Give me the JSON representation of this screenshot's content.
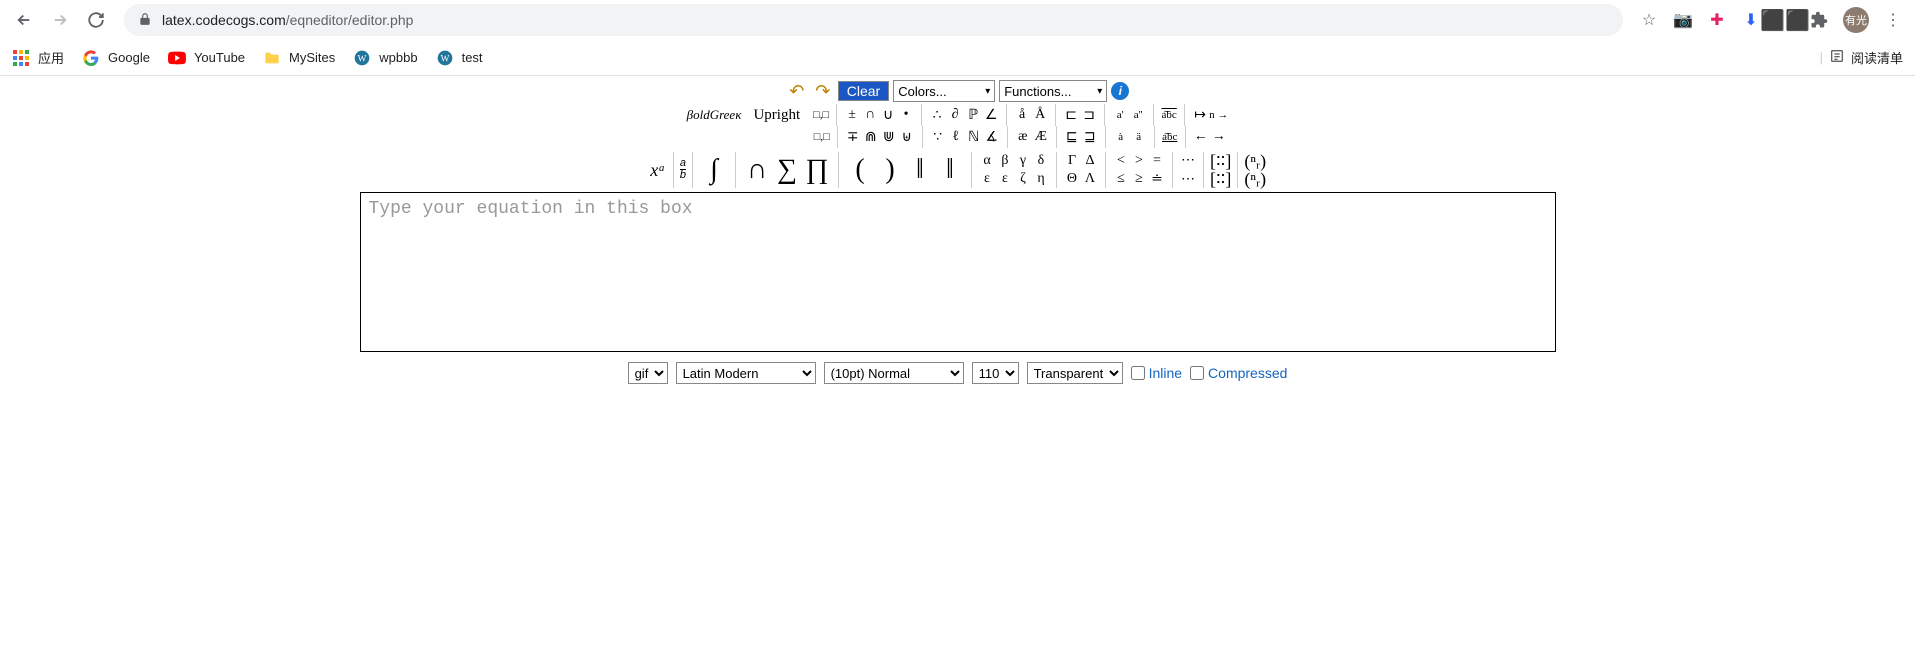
{
  "browser": {
    "url_domain": "latex.codecogs.com",
    "url_path": "/eqneditor/editor.php"
  },
  "bookmarks": {
    "apps": "应用",
    "google": "Google",
    "youtube": "YouTube",
    "mysites": "MySites",
    "wpbbb": "wpbbb",
    "test": "test",
    "reading_list": "阅读清单"
  },
  "toolbar": {
    "clear": "Clear",
    "colors": "Colors...",
    "functions": "Functions..."
  },
  "style_labels": {
    "boldgreek": "βoldGreeκ",
    "upright": "Upright"
  },
  "symbol_rows": {
    "r1a": [
      "□,□",
      "□,□"
    ],
    "r1b": [
      "±",
      "∩",
      "∪",
      "•"
    ],
    "r1c": [
      "∓",
      "⋒",
      "⋓",
      "⊎"
    ],
    "r1d": [
      "∴",
      "∂",
      "ℙ",
      "∠"
    ],
    "r1e": [
      "∵",
      "ℓ",
      "ℕ",
      "∡"
    ],
    "r1f": [
      "å",
      "Å"
    ],
    "r1g": [
      "æ",
      "Æ"
    ],
    "r1h": [
      "⊏",
      "⊐"
    ],
    "r1i": [
      "⊑",
      "⊒"
    ],
    "r1j": [
      "a'",
      "a''"
    ],
    "r1k": [
      "à",
      "ä"
    ],
    "r1l_top": "a͡bc",
    "r1l_bot": "a͡bc",
    "r1m": [
      "↦",
      "n →"
    ],
    "r1n": [
      "←",
      "→"
    ],
    "large": {
      "xa": "xᵃ",
      "frac_top": "a",
      "frac_bot": "b",
      "int": "∫",
      "bigcap": "∩",
      "sum": "∑",
      "prod": "∏",
      "lparen": "(",
      "rparen": ")",
      "vert": "‖",
      "vert2": "‖"
    },
    "greek1": [
      "α",
      "β",
      "γ",
      "δ"
    ],
    "greek2": [
      "ε",
      "ε",
      "ζ",
      "η"
    ],
    "greekU1": [
      "Γ",
      "Δ"
    ],
    "greekU2": [
      "Θ",
      "Λ"
    ],
    "rel1": [
      "<",
      ">",
      "="
    ],
    "rel2": [
      "≤",
      "≥",
      "≐"
    ],
    "dots1": "⋯",
    "dots2": "⋯",
    "matrix_top": "[∶∶]",
    "matrix_bot": "[∶∶]",
    "binom_top": "(ⁿᵣ)",
    "binom_bot": "(ⁿᵣ)"
  },
  "editor": {
    "placeholder": "Type your equation in this box",
    "value": ""
  },
  "controls": {
    "format": "gif",
    "font": "Latin Modern",
    "size": "(10pt) Normal",
    "dpi": "110",
    "bg": "Transparent",
    "inline_label": "Inline",
    "compressed_label": "Compressed"
  },
  "avatar_text": "有光"
}
